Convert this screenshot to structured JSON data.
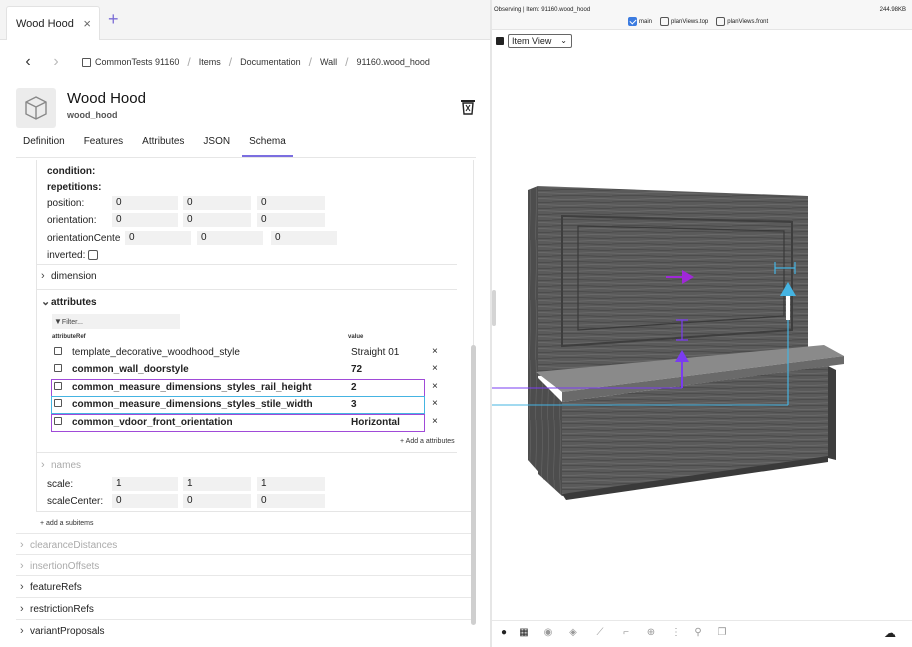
{
  "tab": {
    "title": "Wood Hood",
    "close": "×",
    "new": "+"
  },
  "breadcrumb": {
    "back": "‹",
    "forward": "›",
    "items": [
      "CommonTests 91160",
      "Items",
      "Documentation",
      "Wall",
      "91160.wood_hood"
    ],
    "sep": "/"
  },
  "header": {
    "title": "Wood Hood",
    "subtitle": "wood_hood"
  },
  "tabs": [
    "Definition",
    "Features",
    "Attributes",
    "JSON",
    "Schema"
  ],
  "schema": {
    "condition": "condition:",
    "repetitions": "repetitions:",
    "position": {
      "label": "position:",
      "values": [
        "0",
        "0",
        "0"
      ]
    },
    "orientation": {
      "label": "orientation:",
      "values": [
        "0",
        "0",
        "0"
      ]
    },
    "orientationCenter": {
      "label": "orientationCente",
      "values": [
        "0",
        "0",
        "0"
      ]
    },
    "inverted": "inverted:",
    "dimension": "dimension",
    "attributes": "attributes",
    "filter_placeholder": "Filter...",
    "col_ref": "attributeRef",
    "col_value": "value",
    "rows": [
      {
        "name": "template_decorative_woodhood_style",
        "value": "Straight 01",
        "remove": "×"
      },
      {
        "name": "common_wall_doorstyle",
        "value": "72",
        "remove": "×"
      },
      {
        "name": "common_measure_dimensions_styles_rail_height",
        "value": "2",
        "remove": "×"
      },
      {
        "name": "common_measure_dimensions_styles_stile_width",
        "value": "3",
        "remove": "×"
      },
      {
        "name": "common_vdoor_front_orientation",
        "value": "Horizontal",
        "remove": "×"
      }
    ],
    "add_attributes": "+ Add a attributes",
    "names": "names",
    "scale": {
      "label": "scale:",
      "values": [
        "1",
        "1",
        "1"
      ]
    },
    "scaleCenter": {
      "label": "scaleCenter:",
      "values": [
        "0",
        "0",
        "0"
      ]
    },
    "add_subitems": "+ add a subitems"
  },
  "sections": [
    "clearanceDistances",
    "insertionOffsets",
    "featureRefs",
    "restrictionRefs",
    "variantProposals"
  ],
  "viewer": {
    "observing": "Observing | Item: 91160.wood_hood",
    "size": "244.98KB",
    "options": [
      {
        "label": "main",
        "checked": true
      },
      {
        "label": "planViews.top",
        "checked": false
      },
      {
        "label": "planViews.front",
        "checked": false
      }
    ],
    "view_mode": "Item View"
  },
  "colors": {
    "accent": "#7b6ee0",
    "purple_marker": "#a04ad8",
    "blue_marker": "#45b4e2"
  },
  "icons": [
    "palette-icon",
    "grid-icon",
    "compass-icon",
    "cube-icon",
    "brush-icon",
    "corner-icon",
    "target-icon",
    "dots-icon",
    "person-icon",
    "layers-icon",
    "cloud-download-icon"
  ]
}
